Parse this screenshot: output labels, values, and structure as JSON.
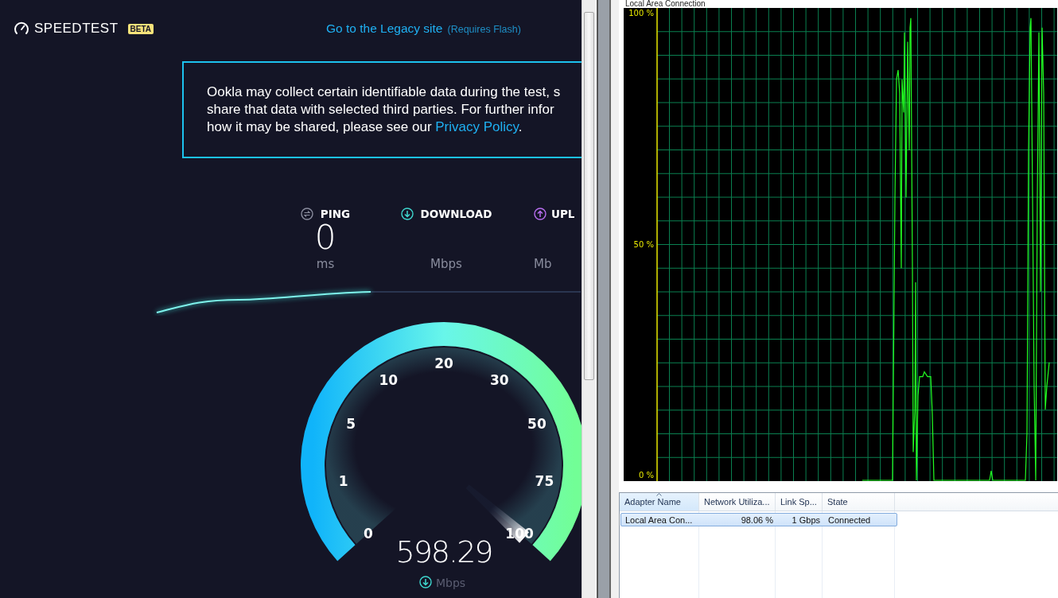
{
  "speedtest": {
    "logo": "SPEEDTEST",
    "badge": "BETA",
    "legacy_link": "Go to the Legacy site",
    "legacy_note": "(Requires Flash)",
    "notice": {
      "line_1": "Ookla may collect certain identifiable data during the test, s",
      "line_2": "share that data with selected third parties. For further infor",
      "line_3": "how it may be shared, please see our ",
      "link": "Privacy Policy",
      "end": "."
    },
    "metrics": [
      {
        "kind": "ping",
        "label": "PING",
        "value": "0",
        "unit": "ms"
      },
      {
        "kind": "download",
        "label": "DOWNLOAD",
        "unit": "Mbps"
      },
      {
        "kind": "upload",
        "label": "UPL",
        "unit": "Mb"
      }
    ],
    "gauge": {
      "scale": [
        "0",
        "1",
        "5",
        "10",
        "20",
        "30",
        "50",
        "75",
        "100"
      ],
      "level": 1,
      "reading": "598.29",
      "unit": "Mbps"
    }
  },
  "monitor": {
    "title": "Local Area Connection",
    "y_labels": [
      "100 %",
      "50 %",
      "0 %"
    ],
    "table": {
      "columns": [
        {
          "label": "Adapter Name",
          "sorted": true
        },
        {
          "label": "Network Utiliza...",
          "sorted": false
        },
        {
          "label": "Link Sp...",
          "sorted": false
        },
        {
          "label": "State",
          "sorted": false
        }
      ],
      "rows": [
        {
          "cells": [
            "Local Area Con...",
            "98.06 %",
            "1 Gbps",
            "Connected"
          ],
          "selected": true
        }
      ]
    }
  }
}
